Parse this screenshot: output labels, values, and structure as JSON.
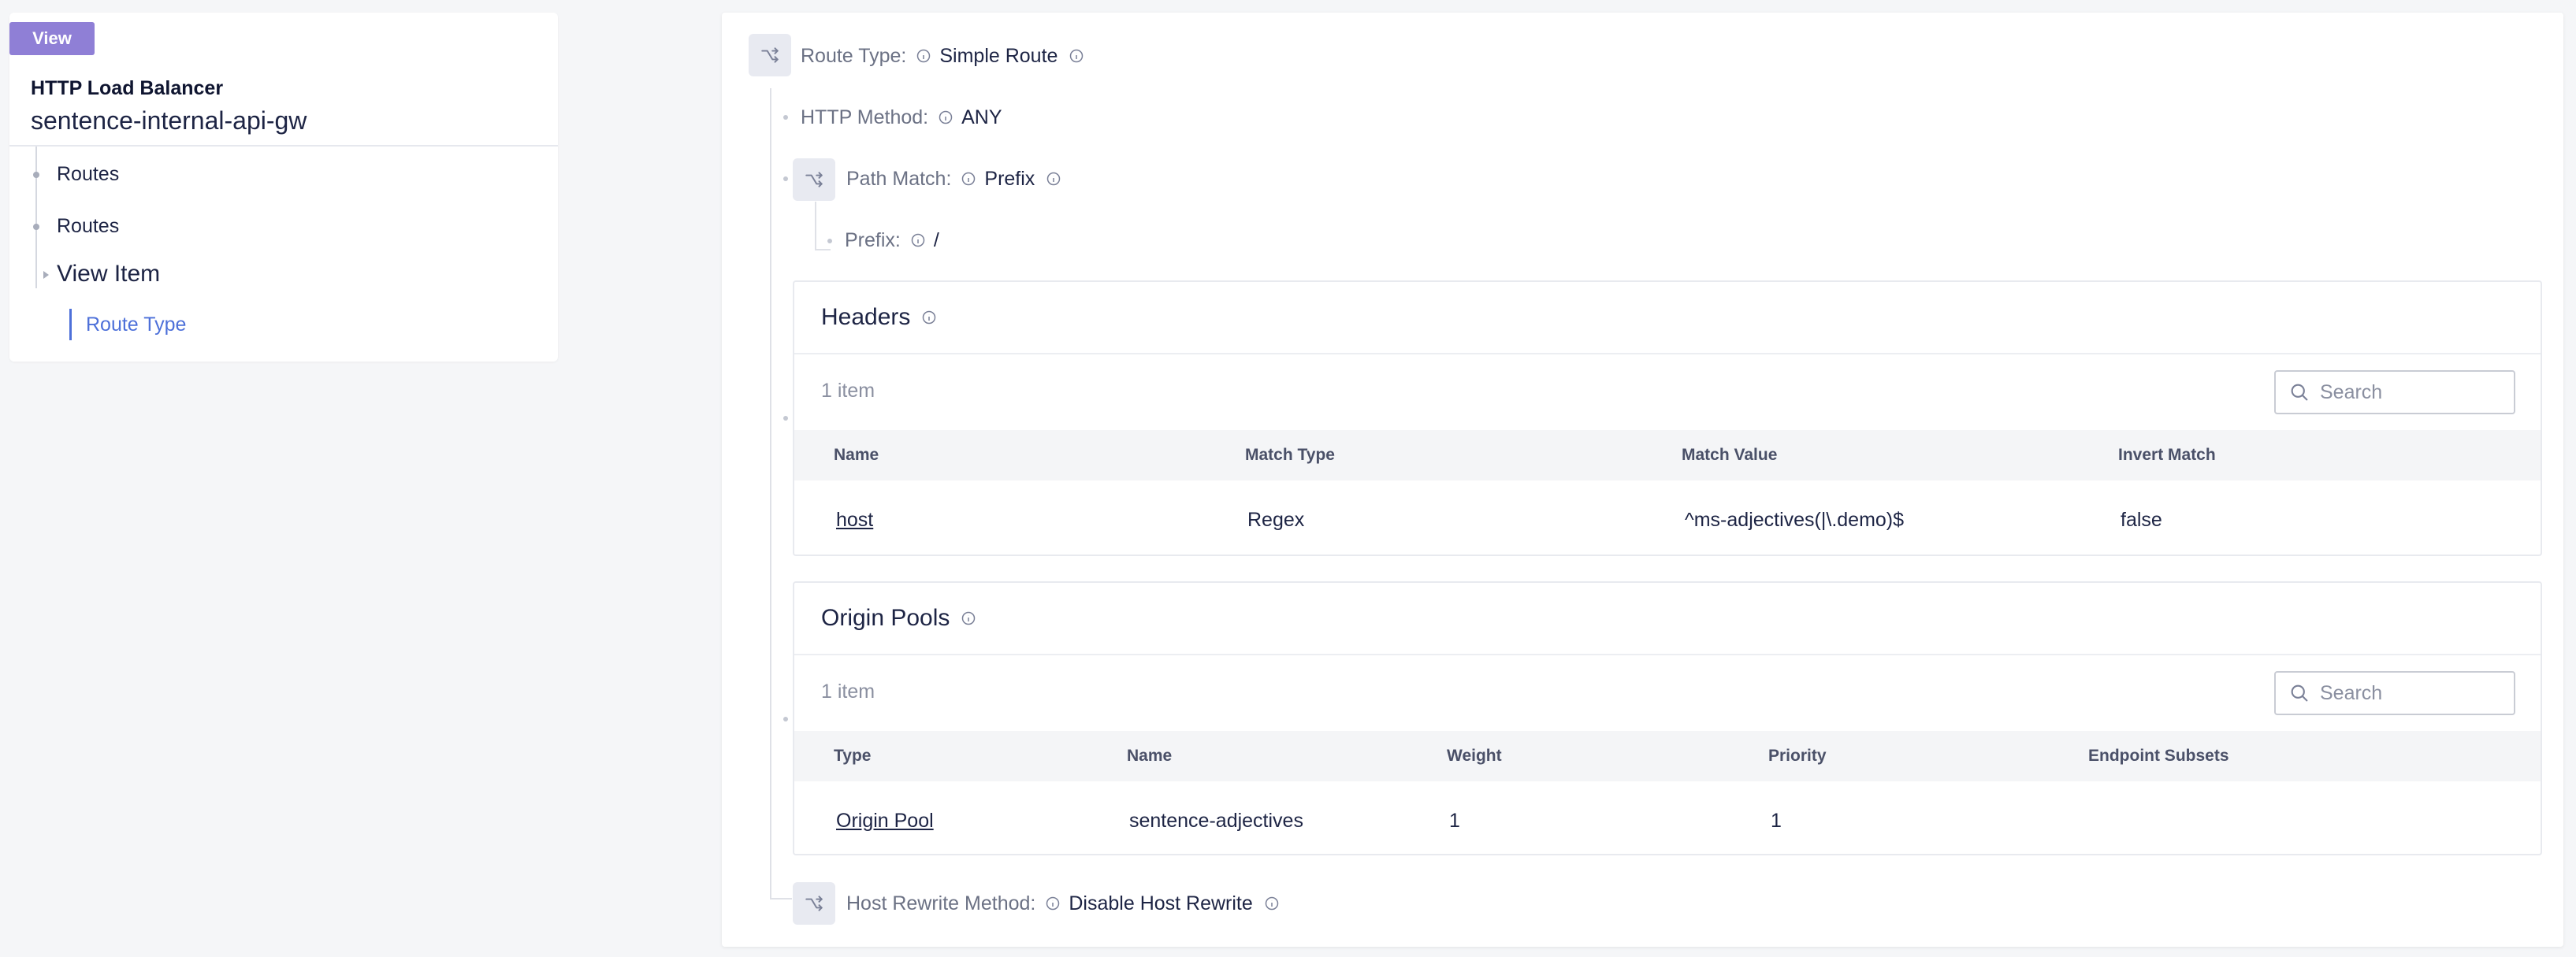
{
  "left": {
    "badge": "View",
    "lb_type": "HTTP Load Balancer",
    "lb_name": "sentence-internal-api-gw",
    "nav": [
      {
        "label": "Routes"
      },
      {
        "label": "Routes"
      },
      {
        "label": "View Item"
      },
      {
        "label": "Route Type"
      }
    ]
  },
  "main": {
    "route_type": {
      "label": "Route Type:",
      "value": "Simple Route"
    },
    "http_method": {
      "label": "HTTP Method:",
      "value": "ANY"
    },
    "path_match": {
      "label": "Path Match:",
      "value": "Prefix"
    },
    "prefix": {
      "label": "Prefix:",
      "value": "/"
    },
    "headers": {
      "title": "Headers",
      "count": "1 item",
      "search_placeholder": "Search",
      "columns": [
        "Name",
        "Match Type",
        "Match Value",
        "Invert Match"
      ],
      "rows": [
        {
          "name": "host",
          "match_type": "Regex",
          "match_value": "^ms-adjectives(|\\.demo)$",
          "invert": "false"
        }
      ]
    },
    "origin_pools": {
      "title": "Origin Pools",
      "count": "1 item",
      "search_placeholder": "Search",
      "columns": [
        "Type",
        "Name",
        "Weight",
        "Priority",
        "Endpoint Subsets"
      ],
      "rows": [
        {
          "type": "Origin Pool",
          "name": "sentence-adjectives",
          "weight": "1",
          "priority": "1",
          "subsets": ""
        }
      ]
    },
    "host_rewrite": {
      "label": "Host Rewrite Method:",
      "value": "Disable Host Rewrite"
    }
  },
  "icons": {
    "route": "route-split-icon",
    "info": "info-icon",
    "search": "search-icon"
  },
  "colors": {
    "badge": "#8f7fd6",
    "active_nav": "#4d70d9",
    "text": "#1d2444"
  }
}
